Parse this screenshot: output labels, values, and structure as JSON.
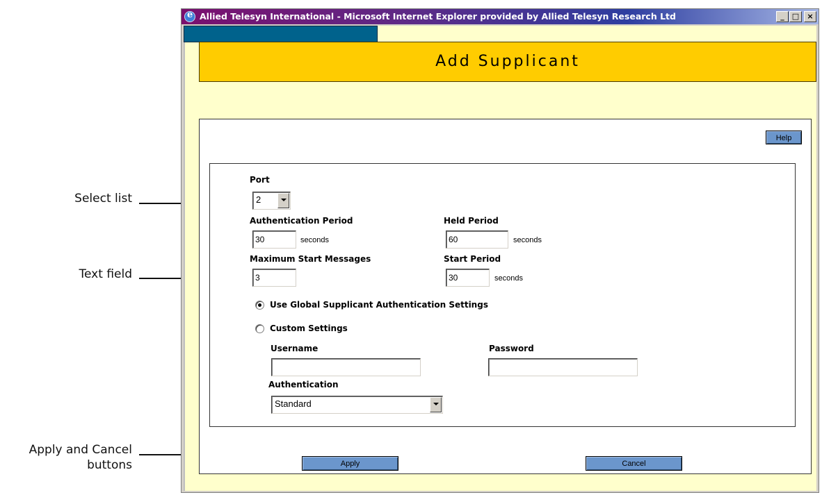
{
  "window": {
    "title": "Allied Telesyn International - Microsoft Internet Explorer provided by Allied Telesyn Research Ltd",
    "minimize": "_",
    "maximize": "□",
    "close": "×"
  },
  "page": {
    "title": "Add Supplicant",
    "help_label": "Help",
    "apply_label": "Apply",
    "cancel_label": "Cancel"
  },
  "form": {
    "port_label": "Port",
    "port_value": "2",
    "auth_period_label": "Authentication Period",
    "auth_period_value": "30",
    "held_period_label": "Held Period",
    "held_period_value": "60",
    "max_start_label": "Maximum Start Messages",
    "max_start_value": "3",
    "start_period_label": "Start Period",
    "start_period_value": "30",
    "seconds_unit": "seconds",
    "use_global_label": "Use Global Supplicant Authentication Settings",
    "use_global_selected": true,
    "custom_label": "Custom Settings",
    "custom_selected": false,
    "username_label": "Username",
    "username_value": "",
    "password_label": "Password",
    "password_value": "",
    "authentication_label": "Authentication",
    "authentication_value": "Standard"
  },
  "callouts": {
    "select_list": "Select list",
    "text_field": "Text field",
    "buttons_line1": "Apply and Cancel",
    "buttons_line2": "buttons"
  }
}
